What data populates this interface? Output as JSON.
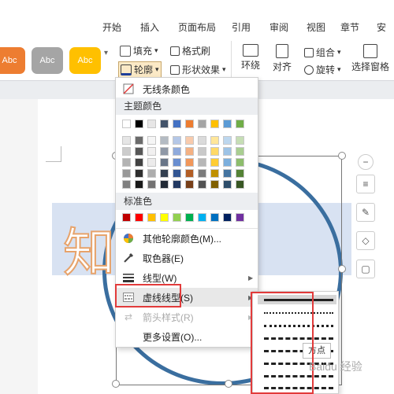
{
  "tabs": [
    "开始",
    "插入",
    "页面布局",
    "引用",
    "审阅",
    "视图",
    "章节",
    "安全"
  ],
  "style_presets": [
    "Abc",
    "Abc",
    "Abc"
  ],
  "colors": {
    "orange": "#ED7D31",
    "gray": "#A5A5A5",
    "yellow": "#FFC000",
    "accent_red": "#E23B3B",
    "circle_blue": "#3A6E9F"
  },
  "ribbon": {
    "fill": "填充",
    "format_painter": "格式刷",
    "outline": "轮廓",
    "shape_effects": "形状效果",
    "surround": "环绕",
    "align": "对齐",
    "group": "组合",
    "rotate": "旋转",
    "selection_pane": "选择窗格"
  },
  "canvas": {
    "big_text": "知 知之"
  },
  "menu": {
    "no_line": "无线条颜色",
    "theme_colors": "主题颜色",
    "standard_colors": "标准色",
    "more_colors": "其他轮廓颜色(M)...",
    "eyedropper": "取色器(E)",
    "line_type": "线型(W)",
    "dash_type": "虚线线型(S)",
    "arrow_style": "箭头样式(R)",
    "more_settings": "更多设置(O)..."
  },
  "theme_row1": [
    "#FFFFFF",
    "#000000",
    "#E7E6E6",
    "#44546A",
    "#4472C4",
    "#ED7D31",
    "#A5A5A5",
    "#FFC000",
    "#5B9BD5",
    "#70AD47"
  ],
  "standard_row": [
    "#C00000",
    "#FF0000",
    "#FFC000",
    "#FFFF00",
    "#92D050",
    "#00B050",
    "#00B0F0",
    "#0070C0",
    "#002060",
    "#7030A0"
  ],
  "tooltip": "方点",
  "watermark": "Baidu 经验"
}
